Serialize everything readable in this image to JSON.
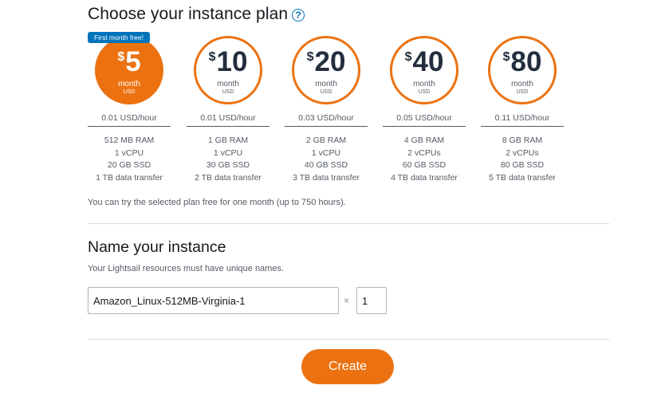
{
  "plan_section": {
    "title": "Choose your instance plan",
    "help_glyph": "?",
    "promo_badge": "First month free!",
    "plans": [
      {
        "currency": "$",
        "amount": "5",
        "period": "month",
        "unit": "USD",
        "hourly": "0.01 USD/hour",
        "ram": "512 MB RAM",
        "cpu": "1 vCPU",
        "ssd": "20 GB SSD",
        "transfer": "1 TB data transfer",
        "selected": true
      },
      {
        "currency": "$",
        "amount": "10",
        "period": "month",
        "unit": "USD",
        "hourly": "0.01 USD/hour",
        "ram": "1 GB RAM",
        "cpu": "1 vCPU",
        "ssd": "30 GB SSD",
        "transfer": "2 TB data transfer",
        "selected": false
      },
      {
        "currency": "$",
        "amount": "20",
        "period": "month",
        "unit": "USD",
        "hourly": "0.03 USD/hour",
        "ram": "2 GB RAM",
        "cpu": "1 vCPU",
        "ssd": "40 GB SSD",
        "transfer": "3 TB data transfer",
        "selected": false
      },
      {
        "currency": "$",
        "amount": "40",
        "period": "month",
        "unit": "USD",
        "hourly": "0.05 USD/hour",
        "ram": "4 GB RAM",
        "cpu": "2 vCPUs",
        "ssd": "60 GB SSD",
        "transfer": "4 TB data transfer",
        "selected": false
      },
      {
        "currency": "$",
        "amount": "80",
        "period": "month",
        "unit": "USD",
        "hourly": "0.11 USD/hour",
        "ram": "8 GB RAM",
        "cpu": "2 vCPUs",
        "ssd": "80 GB SSD",
        "transfer": "5 TB data transfer",
        "selected": false
      }
    ],
    "free_note": "You can try the selected plan free for one month (up to 750 hours)."
  },
  "name_section": {
    "title": "Name your instance",
    "hint": "Your Lightsail resources must have unique names.",
    "instance_name_value": "Amazon_Linux-512MB-Virginia-1",
    "multiplier_glyph": "×",
    "count_value": "1"
  },
  "actions": {
    "create_label": "Create"
  },
  "colors": {
    "accent": "#ec7211",
    "link": "#0073bb",
    "divider": "#d5dbdb"
  },
  "icons": {
    "help": "help-circle-icon"
  }
}
